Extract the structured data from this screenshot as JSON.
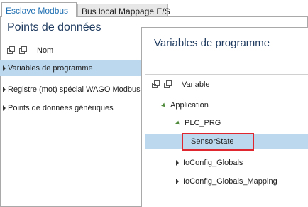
{
  "tabs": [
    {
      "label": "Esclave Modbus",
      "active": true
    },
    {
      "label": "Bus local Mappage E/S",
      "active": false
    }
  ],
  "left_panel": {
    "title": "Points de données",
    "column_header": "Nom",
    "items": [
      {
        "label": "Variables de programme",
        "selected": true
      },
      {
        "label": "Registre (mot) spécial WAGO Modbus",
        "selected": false
      },
      {
        "label": "Points de données génériques",
        "selected": false
      }
    ]
  },
  "popup": {
    "title": "Variables de programme",
    "column_header": "Variable",
    "tree": [
      {
        "label": "Application",
        "expanded": true
      },
      {
        "label": "PLC_PRG",
        "expanded": true
      },
      {
        "label": "SensorState",
        "selected": true,
        "highlighted": true
      },
      {
        "label": "IoConfig_Globals",
        "expanded": false
      },
      {
        "label": "IoConfig_Globals_Mapping",
        "expanded": false
      }
    ]
  },
  "colors": {
    "accent_tab": "#1f6fb2",
    "selection": "#bcd8ee",
    "highlight_border": "#e0262f",
    "expand_arrow": "#4f8a3a"
  }
}
